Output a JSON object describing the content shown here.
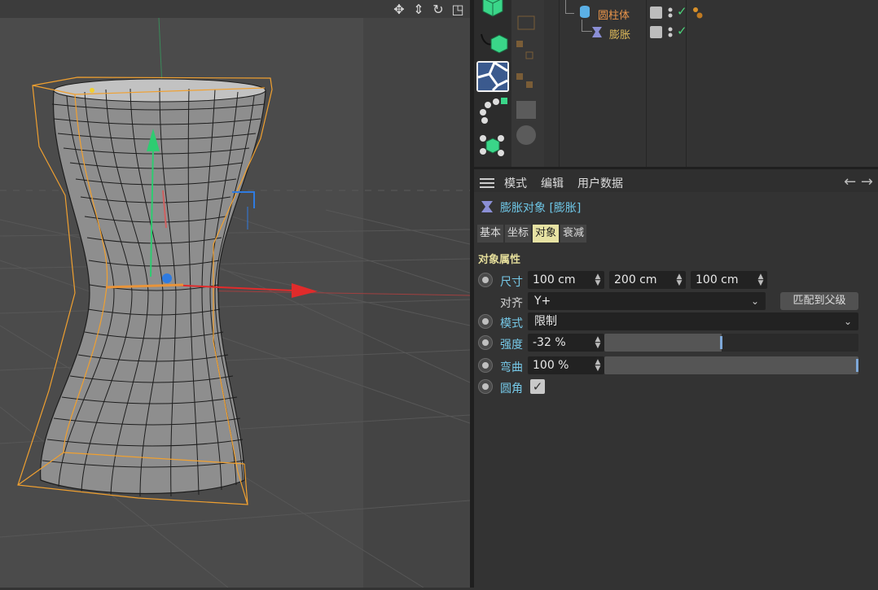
{
  "viewport": {
    "nav_icons": [
      "move-view-icon",
      "dolly-icon",
      "rotate-view-icon",
      "layout-icon"
    ]
  },
  "object_manager": {
    "rows": [
      {
        "name": "圆柱体",
        "color": "#e8944a",
        "icon": "cylinder-icon"
      },
      {
        "name": "膨胀",
        "color": "#ddb95a",
        "icon": "bulge-deformer-icon"
      }
    ]
  },
  "attributes": {
    "menu": [
      "模式",
      "编辑",
      "用户数据"
    ],
    "object_title": "膨胀对象 [膨胀]",
    "tabs": [
      "基本",
      "坐标",
      "对象",
      "衰减"
    ],
    "active_tab": "对象",
    "section_title": "对象属性",
    "size": {
      "label": "尺寸",
      "x": "100 cm",
      "y": "200 cm",
      "z": "100 cm"
    },
    "align": {
      "label": "对齐",
      "value": "Y+",
      "match_button": "匹配到父级"
    },
    "mode": {
      "label": "模式",
      "value": "限制"
    },
    "strength": {
      "label": "强度",
      "value": "-32 %",
      "level": 0.46
    },
    "curvature": {
      "label": "弯曲",
      "value": "100 %",
      "level": 1.0
    },
    "fillet": {
      "label": "圆角",
      "checked": true
    }
  },
  "colors": {
    "accent_label": "#76c9e8",
    "section": "#e4dd9a",
    "active_tab": "#e7e2a3",
    "selection_box": "#f0a030",
    "axis_x": "#e02b2b",
    "axis_y": "#2ecc71",
    "checkmark": "#4cd37a"
  }
}
